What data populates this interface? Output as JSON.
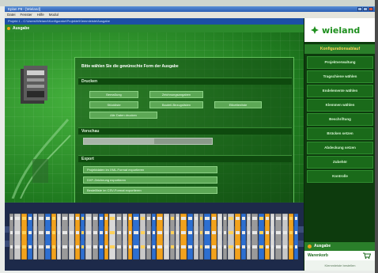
{
  "window": {
    "title": "Eplan P8 - [Wieland]",
    "menu": [
      "Datei",
      "Fenster",
      "Hilfe",
      "Modul"
    ],
    "address": "Projekt 1 - C:\\Users\\Wieland\\Konfigurator\\Projekte\\Klemmleiste\\Ausgabe"
  },
  "panel": {
    "title": "Ausgabe"
  },
  "dialog": {
    "prompt": "Bitte wählen Sie die gewünschte Form der Ausgabe",
    "sections": {
      "print": "Drucken",
      "print_preview": "Vorschau",
      "export": "Export"
    },
    "print_buttons": [
      "Bemaßung",
      "Zeichnungsangaben",
      "Stückliste",
      "Bauteil-Bezugslisten",
      "Etikettenliste",
      "Alle Daten drucken"
    ],
    "progress_value": 0.55,
    "export_buttons": [
      "Projektdaten im XML-Format exportieren",
      "DXF-Zeichnung exportieren",
      "Bestellliste im CSV-Format exportieren"
    ]
  },
  "sidebar": {
    "brand": "wieland",
    "header": "Konfigurationsablauf",
    "items": [
      "Projektverwaltung",
      "Tragschiene wählen",
      "Endelemente wählen",
      "Klemmen wählen",
      "Beschriftung",
      "Brücken setzen",
      "Abdeckung setzen",
      "Zubehör",
      "Kontrolle"
    ],
    "output_label": "Ausgabe",
    "cart_label": "Warenkorb",
    "cart_sub": "Klemmleiste bestellen"
  },
  "colors": {
    "accent": "#2a7f2a",
    "highlight": "#f2a21c",
    "brand": "#1e8f1e"
  }
}
